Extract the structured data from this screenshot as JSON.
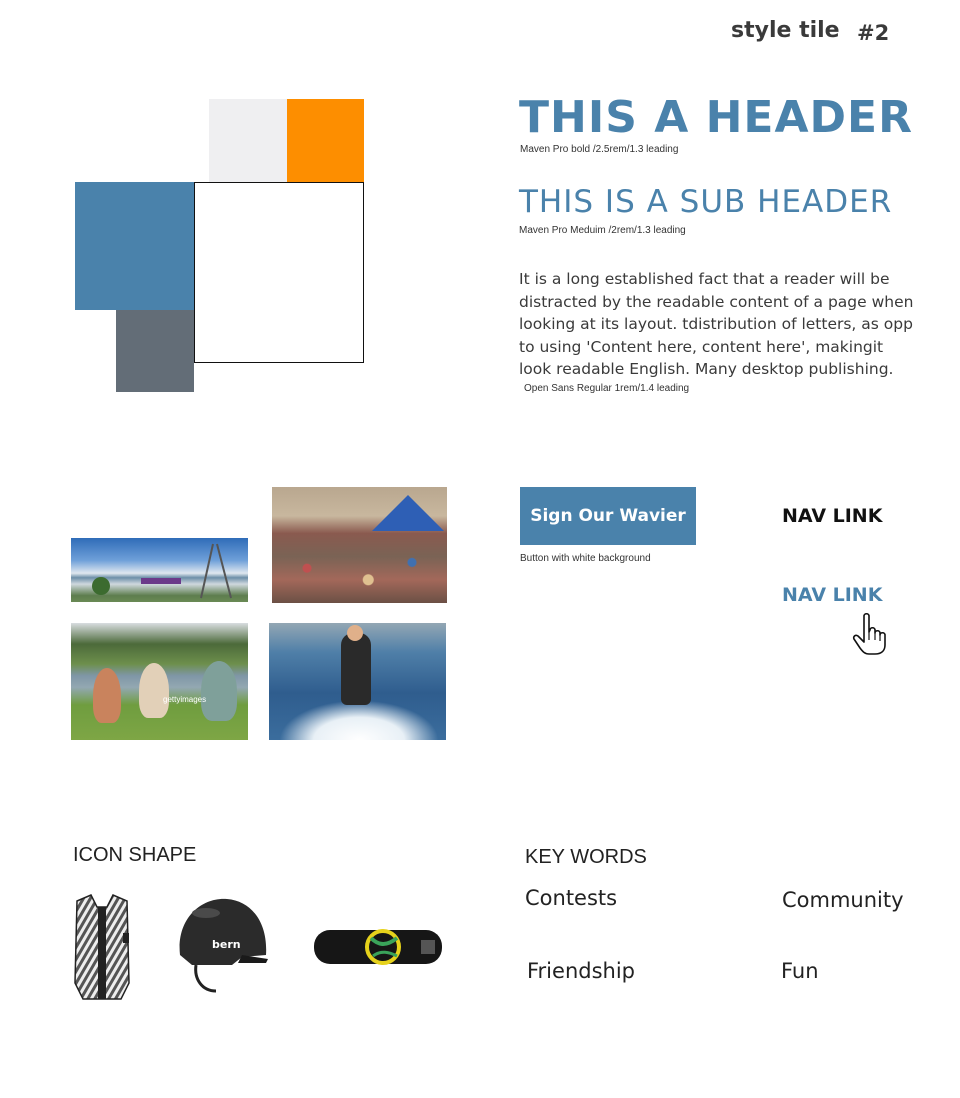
{
  "tile": {
    "title": "style tile",
    "number": "#2"
  },
  "palette": {
    "light": "#efeff1",
    "orange": "#fd8e00",
    "blue": "#4a82ab",
    "white": "#ffffff",
    "gray": "#636d77"
  },
  "typography": {
    "header": "THIS A HEADER",
    "header_note": "Maven Pro bold /2.5rem/1.3 leading",
    "subheader": "THIS IS A SUB HEADER",
    "subheader_note": "Maven Pro Meduim /2rem/1.3 leading",
    "body": "It is a long established fact that a reader will be distracted by the readable content of a page when looking at its layout. tdistribution of letters, as opp to using 'Content here, content here', makingit look readable English. Many desktop publishing.",
    "body_note": "Open Sans Regular 1rem/1.4 leading"
  },
  "photos": {
    "lake_watermark": "",
    "friends_watermark": "gettyimages"
  },
  "cta": {
    "label": "Sign Our Wavier",
    "note": "Button with white background"
  },
  "nav": {
    "link_default": "NAV LINK",
    "link_hover": "NAV LINK",
    "cursor_icon": "hand-pointer-icon"
  },
  "icon_shape": {
    "heading": "ICON SHAPE",
    "icons": [
      "life-vest-icon",
      "helmet-icon",
      "wakeboard-icon"
    ],
    "helmet_brand": "bern"
  },
  "keywords": {
    "heading": "KEY WORDS",
    "items": [
      "Contests",
      "Community",
      "Friendship",
      "Fun"
    ]
  }
}
